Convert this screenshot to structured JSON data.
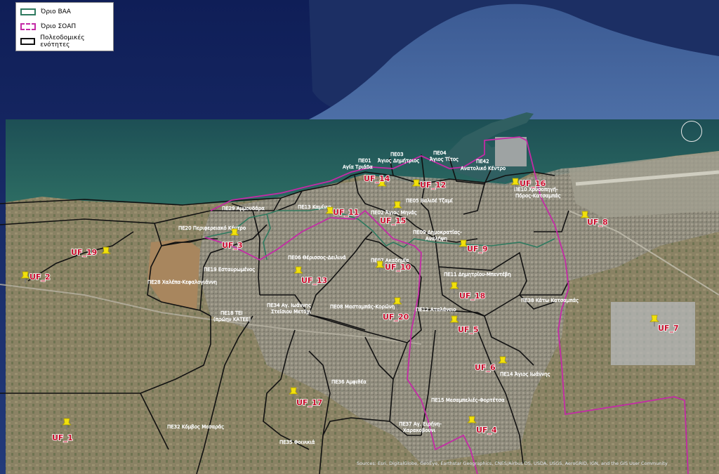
{
  "legend": {
    "items": [
      {
        "label": "Όριο ΒΑΑ",
        "color": "#2e7a5f"
      },
      {
        "label": "Όριο ΣΟΑΠ",
        "color": "#c42aa6"
      },
      {
        "label": "Πολεοδομικές ενότητες",
        "color": "#111111"
      }
    ]
  },
  "units": [
    {
      "id": "pe01",
      "text": "ΠΕ01"
    },
    {
      "id": "pe01b",
      "text": "Αγία Τριάδα"
    },
    {
      "id": "pe03",
      "text": "ΠΕ03"
    },
    {
      "id": "pe03b",
      "text": "Άγιος Δημήτριος"
    },
    {
      "id": "pe04",
      "text": "ΠΕ04"
    },
    {
      "id": "pe04b",
      "text": "Άγιος Τίτος"
    },
    {
      "id": "pe42",
      "text": "ΠΕ42"
    },
    {
      "id": "pe42b",
      "text": "Ανατολικό Κέντρο"
    },
    {
      "id": "pe05",
      "text": "ΠΕ05 Βαλιδέ Τζαμί"
    },
    {
      "id": "pe02",
      "text": "ΠΕ02 Άγιος Μηνάς"
    },
    {
      "id": "pe10",
      "text": "ΠΕ10 Χρυσοπηγή-"
    },
    {
      "id": "pe10b",
      "text": "Πόρος-Κατσαμπάς"
    },
    {
      "id": "pe29",
      "text": "ΠΕ29 Αμμουδάρα"
    },
    {
      "id": "pe13",
      "text": "ΠΕ13 Καμίνια"
    },
    {
      "id": "pe20",
      "text": "ΠΕ20 Περιφερειακό Κέντρο"
    },
    {
      "id": "pe09",
      "text": "ΠΕ09 Δημοκρατίας-"
    },
    {
      "id": "pe09b",
      "text": "Αναλήψη"
    },
    {
      "id": "pe06",
      "text": "ΠΕ06 Θέρισσος-Δειλινά"
    },
    {
      "id": "pe07",
      "text": "ΠΕ07 Ακαδημία"
    },
    {
      "id": "pe19",
      "text": "ΠΕ19 Εσταυρωμένος"
    },
    {
      "id": "pe11",
      "text": "ΠΕ11 Δημητρίου-Μπεντέβη"
    },
    {
      "id": "pe28",
      "text": "ΠΕ28 Χαλέπα-Κεφαλογιάννη"
    },
    {
      "id": "pe38",
      "text": "ΠΕ38 Κάτω Κατσαμπάς"
    },
    {
      "id": "pe34",
      "text": "ΠΕ34 Αγ. Ιωάννης"
    },
    {
      "id": "pe34b",
      "text": "Στείσιου Μετόχι"
    },
    {
      "id": "pe08",
      "text": "ΠΕ08 Μασταμπάς-Κορώνη"
    },
    {
      "id": "pe12",
      "text": "ΠΕ12 Αταλάνειο"
    },
    {
      "id": "pe18",
      "text": "ΠΕ18 ΤΕΙ"
    },
    {
      "id": "pe18b",
      "text": "(πρώην ΚΑΤΕΕ)"
    },
    {
      "id": "pe14",
      "text": "ΠΕ14 Άγιος Ιωάννης"
    },
    {
      "id": "pe36",
      "text": "ΠΕ36 Αμφιθέα"
    },
    {
      "id": "pe15",
      "text": "ΠΕ15 Μεσαμπελιές-Φορτέτσα"
    },
    {
      "id": "pe32",
      "text": "ΠΕ32 Κόμβος Μεσαράς"
    },
    {
      "id": "pe37",
      "text": "ΠΕ37 Αγ. Ειρήνη-"
    },
    {
      "id": "pe37b",
      "text": "Χαρακοβουνι"
    },
    {
      "id": "pe35",
      "text": "ΠΕ35 Φοινικιά"
    }
  ],
  "markers": [
    {
      "id": "uf14",
      "label": "UF_14"
    },
    {
      "id": "uf12",
      "label": "UF_12"
    },
    {
      "id": "uf16",
      "label": "UF_16"
    },
    {
      "id": "uf11",
      "label": "UF_11"
    },
    {
      "id": "uf15",
      "label": "UF_15"
    },
    {
      "id": "uf8",
      "label": "UF_8"
    },
    {
      "id": "uf3",
      "label": "UF_3"
    },
    {
      "id": "uf19",
      "label": "UF_19"
    },
    {
      "id": "uf9",
      "label": "UF_9"
    },
    {
      "id": "uf10",
      "label": "UF_10"
    },
    {
      "id": "uf2",
      "label": "UF_2"
    },
    {
      "id": "uf13",
      "label": "UF_13"
    },
    {
      "id": "uf18",
      "label": "UF_18"
    },
    {
      "id": "uf20",
      "label": "UF_20"
    },
    {
      "id": "uf7",
      "label": "UF_7"
    },
    {
      "id": "uf5",
      "label": "UF_5"
    },
    {
      "id": "uf6",
      "label": "UF_6"
    },
    {
      "id": "uf17",
      "label": "UF_17"
    },
    {
      "id": "uf1",
      "label": "UF_1"
    },
    {
      "id": "uf4",
      "label": "UF_4"
    }
  ],
  "attribution": "Sources: Esri, DigitalGlobe, GeoEye, Earthstar Geographics, CNES/Airbus DS, USDA, USGS, AeroGRID, IGN, and the GIS User Community",
  "colors": {
    "vaa": "#2e7a5f",
    "soap": "#c42aa6",
    "units": "#111111",
    "uf_label": "#c8102e",
    "pin": "#f2e10b"
  }
}
